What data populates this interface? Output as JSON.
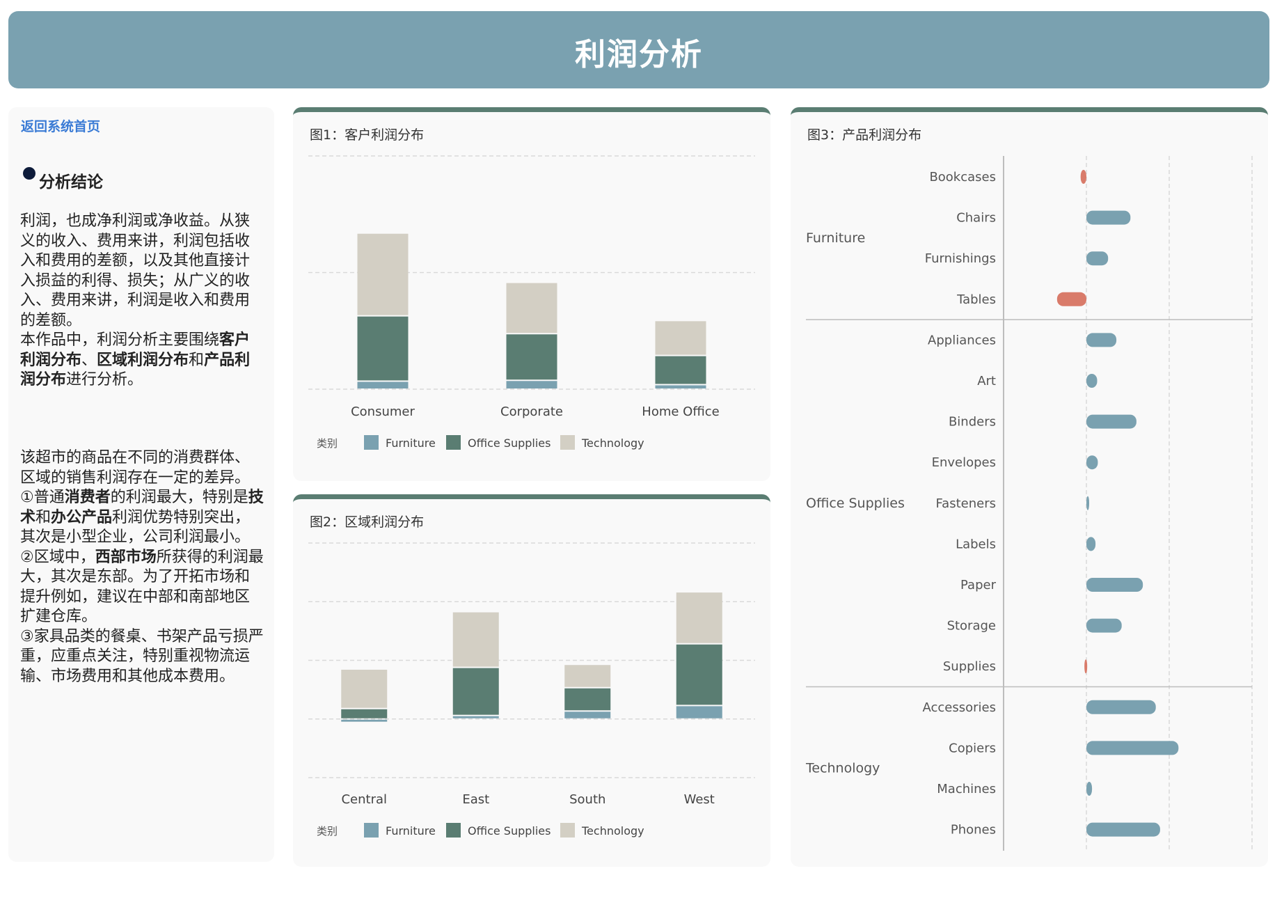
{
  "header": {
    "title": "利润分析"
  },
  "sidebar": {
    "back_link": "返回系统首页",
    "conclusion_title": "分析结论",
    "p1": {
      "t1": "利润，也成净利润或净收益。从狭义的收入、费用来讲，利润包括收入和费用的差额，以及其他直接计入损益的利得、损失；从广义的收入、费用来讲，利润是收入和费用的差额。",
      "t2": "本作品中，利润分析主要围绕",
      "b1": "客户利润分布",
      "s1": "、",
      "b2": "区域利润分布",
      "s2": "和",
      "b3": "产品利润分布",
      "t3": "进行分析。"
    },
    "p2": {
      "intro": "该超市的商品在不同的消费群体、区域的销售利润存在一定的差异。",
      "a1": "①普通",
      "a2": "消费者",
      "a3": "的利润最大，特别是",
      "a4": "技术",
      "a5": "和",
      "a6": "办公产品",
      "a7": "利润优势特别突出，其次是小型企业，公司利润最小。",
      "b1": "②区域中，",
      "b2": "西部市场",
      "b3": "所获得的利润最大，其次是东部。为了开拓市场和提升例如，建议在中部和南部地区扩建仓库。",
      "c1": "③家具品类的餐桌、书架产品亏损严重，应重点关注，特别重视物流运输、市场费用和其他成本费用。"
    }
  },
  "colors": {
    "furniture": "#7aa1b0",
    "office": "#5a7d72",
    "technology": "#d3cfc4",
    "negative": "#d97b6a",
    "grid": "#d9d9d9"
  },
  "chart_data": [
    {
      "id": "chart1",
      "title": "图1：客户利润分布",
      "type": "bar",
      "stacked": true,
      "categories": [
        "Consumer",
        "Corporate",
        "Home Office"
      ],
      "series": [
        {
          "name": "Furniture",
          "values": [
            6900,
            7600,
            3900
          ]
        },
        {
          "name": "Office Supplies",
          "values": [
            56000,
            40000,
            25000
          ]
        },
        {
          "name": "Technology",
          "values": [
            71000,
            44000,
            30000
          ]
        }
      ],
      "ylim": [
        0,
        200000
      ],
      "legend": {
        "title": "类别",
        "position": "bottom-left"
      },
      "grid": true
    },
    {
      "id": "chart2",
      "title": "图2：区域利润分布",
      "type": "bar",
      "stacked": true,
      "categories": [
        "Central",
        "East",
        "South",
        "West"
      ],
      "series": [
        {
          "name": "Furniture",
          "values": [
            -2900,
            3000,
            6800,
            11500
          ]
        },
        {
          "name": "Office Supplies",
          "values": [
            8900,
            41000,
            19900,
            52600
          ]
        },
        {
          "name": "Technology",
          "values": [
            33700,
            47500,
            19900,
            44300
          ]
        }
      ],
      "ylim": [
        -50000,
        150000
      ],
      "legend": {
        "title": "类别",
        "position": "bottom-left"
      },
      "grid": true
    },
    {
      "id": "chart3",
      "title": "图3：产品利润分布",
      "type": "bar",
      "orientation": "horizontal",
      "groups": [
        {
          "name": "Furniture",
          "items": [
            {
              "name": "Bookcases",
              "value": -3500
            },
            {
              "name": "Chairs",
              "value": 26600
            },
            {
              "name": "Furnishings",
              "value": 13100
            },
            {
              "name": "Tables",
              "value": -17700
            }
          ]
        },
        {
          "name": "Office Supplies",
          "items": [
            {
              "name": "Appliances",
              "value": 18100
            },
            {
              "name": "Art",
              "value": 6500
            },
            {
              "name": "Binders",
              "value": 30200
            },
            {
              "name": "Envelopes",
              "value": 6900
            },
            {
              "name": "Fasteners",
              "value": 950
            },
            {
              "name": "Labels",
              "value": 5500
            },
            {
              "name": "Paper",
              "value": 34100
            },
            {
              "name": "Storage",
              "value": 21300
            },
            {
              "name": "Supplies",
              "value": -1200
            }
          ]
        },
        {
          "name": "Technology",
          "items": [
            {
              "name": "Accessories",
              "value": 41900
            },
            {
              "name": "Copiers",
              "value": 55600
            },
            {
              "name": "Machines",
              "value": 3400
            },
            {
              "name": "Phones",
              "value": 44500
            }
          ]
        }
      ],
      "xlim": [
        -50000,
        100000
      ],
      "grid": true
    }
  ]
}
